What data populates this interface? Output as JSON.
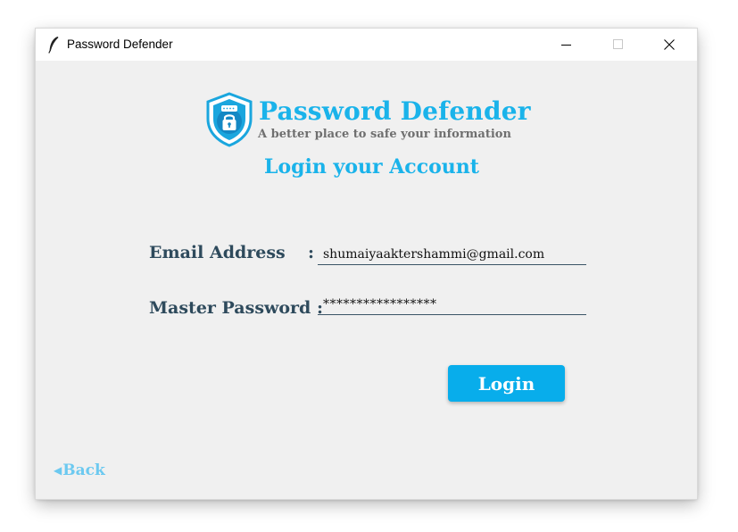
{
  "window": {
    "title": "Password Defender"
  },
  "brand": {
    "title": "Password Defender",
    "tagline": "A better place to safe your information",
    "accent_color": "#1ab3ea"
  },
  "form": {
    "heading": "Login your Account",
    "email_label": "Email Address",
    "email_colon": ":",
    "email_value": "shumaiyaaktershammi@gmail.com",
    "password_label": "Master Password :",
    "password_value": "*****************"
  },
  "actions": {
    "login_label": "Login",
    "back_label": "Back",
    "back_icon": "left-triangle-icon"
  },
  "icons": {
    "app": "feather-icon",
    "logo": "shield-lock-icon",
    "minimize": "minimize-icon",
    "maximize": "maximize-icon",
    "close": "close-icon"
  }
}
